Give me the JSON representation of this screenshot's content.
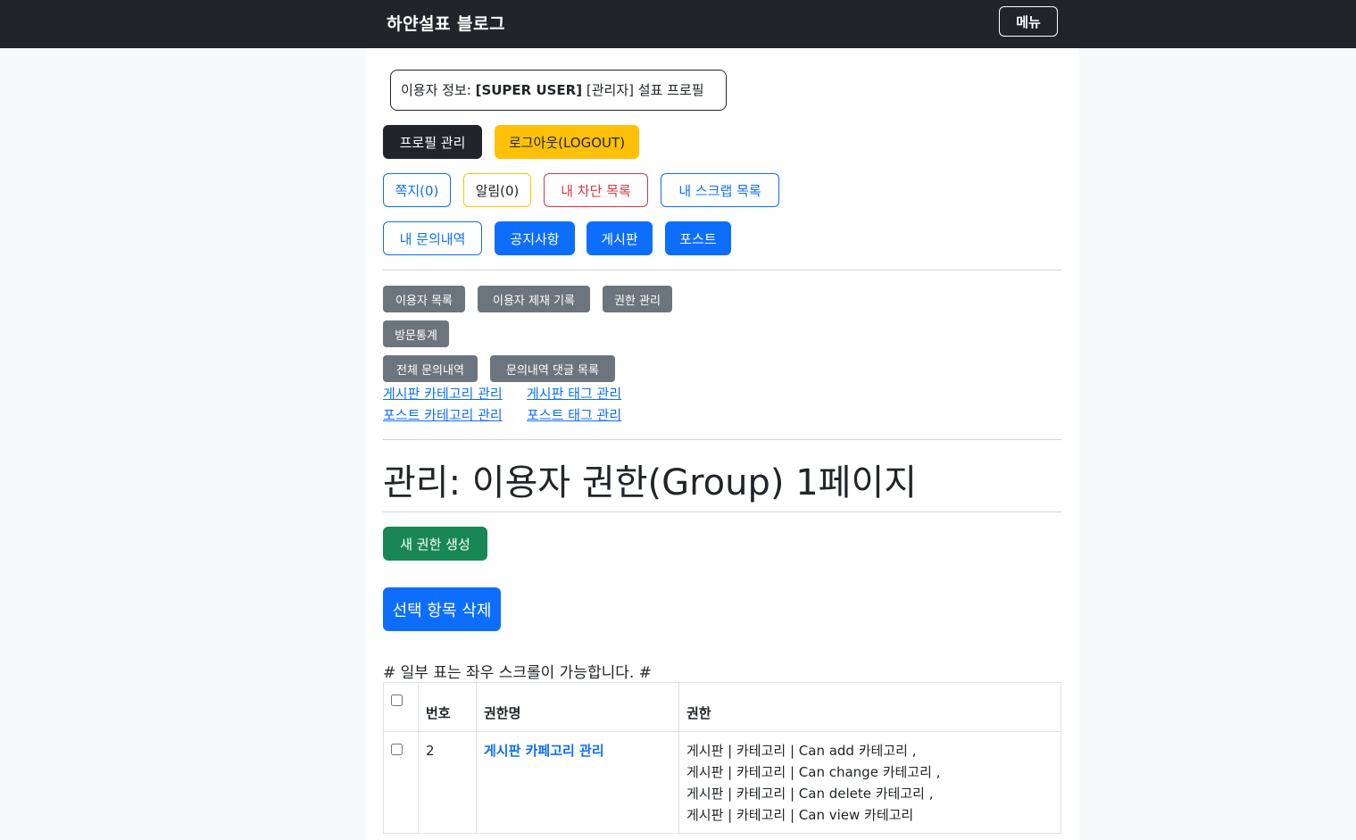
{
  "navbar": {
    "brand": "하얀설표 블로그",
    "menu_label": "메뉴"
  },
  "user_info": {
    "prefix": "이용자 정보: ",
    "role": "[SUPER USER]",
    "name": " [관리자] 설표 프로필"
  },
  "buttons_row1": {
    "profile": "프로필 관리",
    "logout": "로그아웃(LOGOUT)"
  },
  "buttons_row2": {
    "messages": "쪽지(0)",
    "alerts": "알림(0)",
    "blocked": "내 차단 목록",
    "scraps": "내 스크랩 목록"
  },
  "buttons_row3": {
    "inquiries": "내 문의내역",
    "notice": "공지사항",
    "board": "게시판",
    "post": "포스트"
  },
  "admin_buttons": {
    "users": "이용자 목록",
    "sanctions": "이용자 제재 기록",
    "permissions": "권한 관리",
    "stats": "방문통계",
    "all_inquiries": "전체 문의내역",
    "inquiry_comments": "문의내역 댓글 목록"
  },
  "admin_links": {
    "board_category": "게시판 카테고리 관리",
    "board_tag": "게시판 태그 관리",
    "post_category": "포스트 카테고리 관리",
    "post_tag": "포스트 태그 관리"
  },
  "page": {
    "title": "관리: 이용자 권한(Group) 1페이지",
    "create_button": "새 권한 생성",
    "delete_button": "선택 항목 삭제",
    "scroll_note": "# 일부 표는 좌우 스크롤이 가능합니다. #"
  },
  "table": {
    "headers": {
      "number": "번호",
      "name": "권한명",
      "permissions": "권한"
    },
    "rows": [
      {
        "number": "2",
        "name": "게시판 카페고리 관리",
        "permissions": [
          "게시판 | 카테고리 | Can add 카테고리 ,",
          "게시판 | 카테고리 | Can change 카테고리 ,",
          "게시판 | 카테고리 | Can delete 카테고리 ,",
          "게시판 | 카테고리 | Can view 카테고리"
        ]
      }
    ]
  }
}
